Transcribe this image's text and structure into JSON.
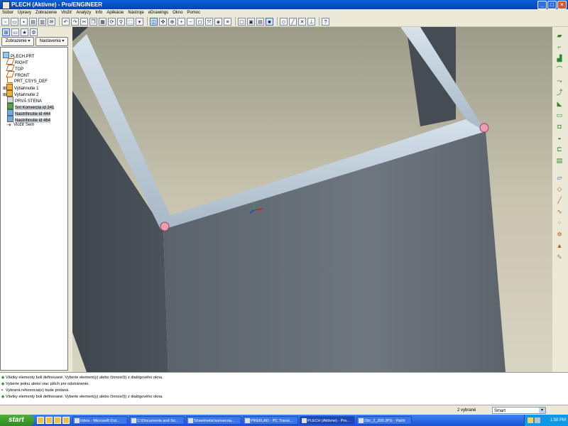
{
  "window": {
    "title": "PLECH (Aktívne) - Pro/ENGINEER"
  },
  "menu": [
    "Súbor",
    "Úpravy",
    "Zobrazenie",
    "Vložiť",
    "Analýzy",
    "Info",
    "Aplikácie",
    "Nástroje",
    "eDrawings",
    "Okno",
    "Pomoc"
  ],
  "left_panel": {
    "tabs": [
      "Zobrazenie ▾",
      "Nastavenia ▾"
    ],
    "tree": [
      {
        "label": "PLECH.PRT",
        "icon": "part-icon",
        "selected": false
      },
      {
        "label": "RIGHT",
        "icon": "datum-plane-icon",
        "selected": false
      },
      {
        "label": "TOP",
        "icon": "datum-plane-icon",
        "selected": false
      },
      {
        "label": "FRONT",
        "icon": "datum-plane-icon",
        "selected": false
      },
      {
        "label": "PRT_CSYS_DEF",
        "icon": "csys-icon",
        "selected": false
      },
      {
        "label": "Vytiahnutie 1",
        "icon": "extrude-icon",
        "selected": false
      },
      {
        "label": "Vytiahnutie 2",
        "icon": "extrude-icon",
        "selected": false
      },
      {
        "label": "PRVÁ STENA",
        "icon": "wall-icon",
        "selected": false
      },
      {
        "label": "Snt  Konverzia id 241",
        "icon": "conversion-icon",
        "selected": true
      },
      {
        "label": "Nastrihnutie id 444",
        "icon": "rip-icon",
        "selected": true
      },
      {
        "label": "Nastrihnutie id 464",
        "icon": "rip-icon",
        "selected": true
      },
      {
        "label": "Vložiť Sem",
        "icon": "insert-here-icon",
        "selected": false
      }
    ]
  },
  "messages": [
    "Všetky elementy boli definované. Vyberte element(y) alebo činnosť(i) z dialógového okna.",
    "Vyberte jednu alebo viac plôch pre odstránenie.",
    "Vybraná referencia(e) bude pridaná.",
    "Všetky elementy boli definované. Vyberte element(y) alebo činnosť(i) z dialógového okna."
  ],
  "status": {
    "selected_count": "2 vybrané",
    "filter": "Smart"
  },
  "taskbar": {
    "start_label": "start",
    "tasks": [
      "Inbox - Microsoft Out...",
      "C:\\Documents and Se...",
      "Sheetmetal konverzia...",
      "PREKLAD - PC Transl...",
      "PLECH (Aktívne) - Pro...",
      "Obr_2_200.JPG - Paint"
    ],
    "clock": "1:58 PM"
  }
}
